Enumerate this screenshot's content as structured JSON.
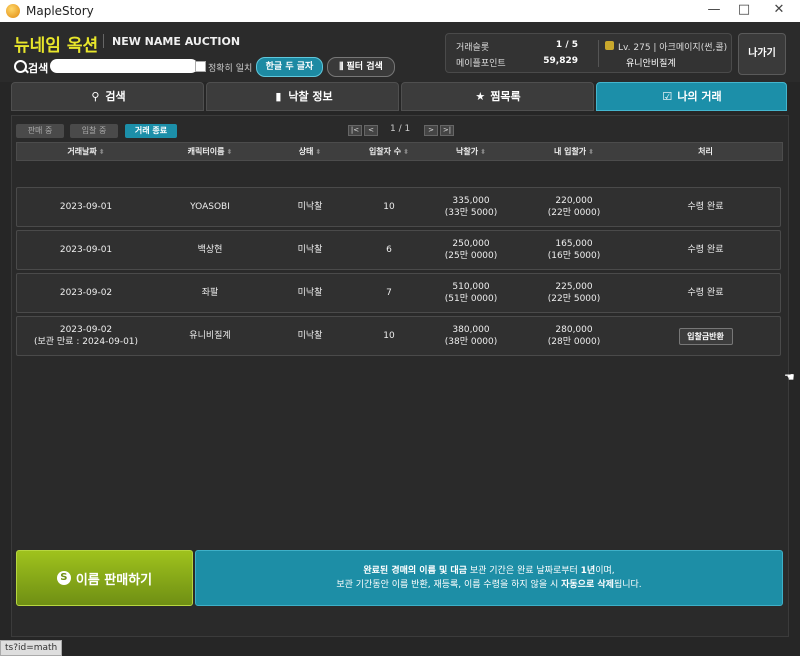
{
  "window": {
    "title": "MapleStory",
    "minimize": "—",
    "maximize": "□",
    "close": "✕"
  },
  "header": {
    "brand": "뉴네임 옥션",
    "brand_en": "NEW NAME AUCTION",
    "search_label": "검색",
    "search_value": "",
    "exact_match_label": "정확히 일치",
    "korean_two_chars": "한글 두 글자",
    "filter_search": "필터 검색",
    "slot_label": "거래슬롯",
    "slot_value": "1 / 5",
    "maple_points_label": "메이플포인트",
    "maple_points_value": "59,829",
    "char_level": "Lv. 275 | 아크메이지(썬,콜)",
    "char_name": "유니안비질계",
    "exit_button": "나가기"
  },
  "tabs": [
    {
      "label": "검색",
      "icon": "search-icon"
    },
    {
      "label": "낙찰 정보",
      "icon": "bar-chart-icon"
    },
    {
      "label": "찜목록",
      "icon": "star-icon"
    },
    {
      "label": "나의 거래",
      "icon": "checkbox-icon",
      "active": true
    }
  ],
  "subtabs": [
    {
      "label": "판매 중"
    },
    {
      "label": "입찰 중"
    },
    {
      "label": "거래 종료",
      "active": true
    }
  ],
  "pager": {
    "text": "1 / 1",
    "first": "|<",
    "prev": "<",
    "next": ">",
    "last": ">|"
  },
  "table": {
    "headers": [
      "거래날짜",
      "캐릭터이름",
      "상태",
      "입찰자 수",
      "낙찰가",
      "내 입찰가",
      "처리"
    ],
    "rows": [
      {
        "date": "2023-09-01",
        "date_note": "",
        "name": "YOASOBI",
        "status": "미낙찰",
        "bidders": "10",
        "win_price": "335,000",
        "win_price_sub": "(33만 5000)",
        "my_bid": "220,000",
        "my_bid_sub": "(22만 0000)",
        "action": "수령 완료",
        "action_is_button": false
      },
      {
        "date": "2023-09-01",
        "date_note": "",
        "name": "백상현",
        "status": "미낙찰",
        "bidders": "6",
        "win_price": "250,000",
        "win_price_sub": "(25만 0000)",
        "my_bid": "165,000",
        "my_bid_sub": "(16만 5000)",
        "action": "수령 완료",
        "action_is_button": false
      },
      {
        "date": "2023-09-02",
        "date_note": "",
        "name": "좌팔",
        "status": "미낙찰",
        "bidders": "7",
        "win_price": "510,000",
        "win_price_sub": "(51만 0000)",
        "my_bid": "225,000",
        "my_bid_sub": "(22만 5000)",
        "action": "수령 완료",
        "action_is_button": false
      },
      {
        "date": "2023-09-02",
        "date_note": "(보관 만료 : 2024-09-01)",
        "name": "유니비질계",
        "status": "미낙찰",
        "bidders": "10",
        "win_price": "380,000",
        "win_price_sub": "(38만 0000)",
        "my_bid": "280,000",
        "my_bid_sub": "(28만 0000)",
        "action": "입찰금반환",
        "action_is_button": true
      }
    ]
  },
  "sell_button": {
    "icon_text": "S",
    "label": "이름 판매하기"
  },
  "notice": {
    "line1_bold": "완료된 경매의 이름 및 대금",
    "line1_rest": " 보관 기간은 완료 날짜로부터 ",
    "line1_bold2": "1년",
    "line1_end": "이며,",
    "line2": "보관 기간동안 이름 반환, 재등록, 이름 수령을 하지 않을 시 ",
    "line2_bold": "자동으로 삭제",
    "line2_end": "됩니다."
  },
  "status_url": "ts?id=math",
  "colors": {
    "accent": "#1c8fa9",
    "brand": "#e8e62b",
    "sell": "#8fb31a"
  }
}
